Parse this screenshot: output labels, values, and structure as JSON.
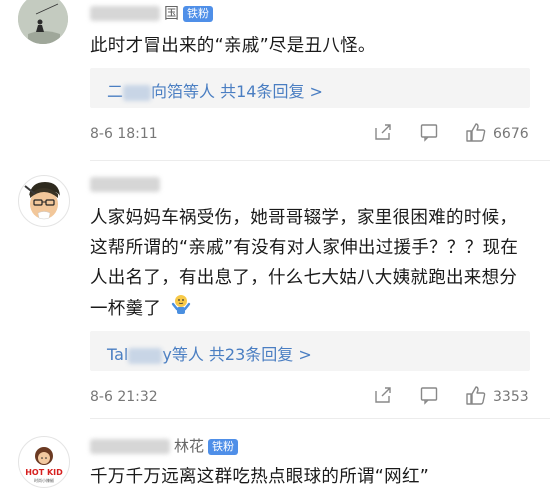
{
  "comments": [
    {
      "username_visible": "国",
      "badge": "铁粉",
      "text": "此时才冒出来的“亲戚”尽是丑八怪。",
      "reply_prefix": "二",
      "reply_suffix": "向箔等人 共14条回复 >",
      "time": "8-6 18:11",
      "likes": "6676"
    },
    {
      "username_visible": "",
      "badge": "",
      "text": "人家妈妈车祸受伤，她哥哥辍学，家里很困难的时候，这帮所谓的“亲戚”有没有对人家伸出过援手？？？现在人出名了，有出息了，什么七大姑八大姨就跑出来想分一杯羹了",
      "emoji": "emoji-shrug",
      "reply_prefix": "Tal",
      "reply_suffix": "y等人 共23条回复 >",
      "time": "8-6 21:32",
      "likes": "3353"
    },
    {
      "username_visible": "林花",
      "badge": "铁粉",
      "avatar_text": "HOT KID",
      "avatar_sub": "时尚小辣椒",
      "text": "千万千万远离这群吃热点眼球的所谓“网红”"
    }
  ],
  "colors": {
    "link": "#4a7ec2",
    "badge": "#4f8fe8",
    "meta": "#777777"
  }
}
